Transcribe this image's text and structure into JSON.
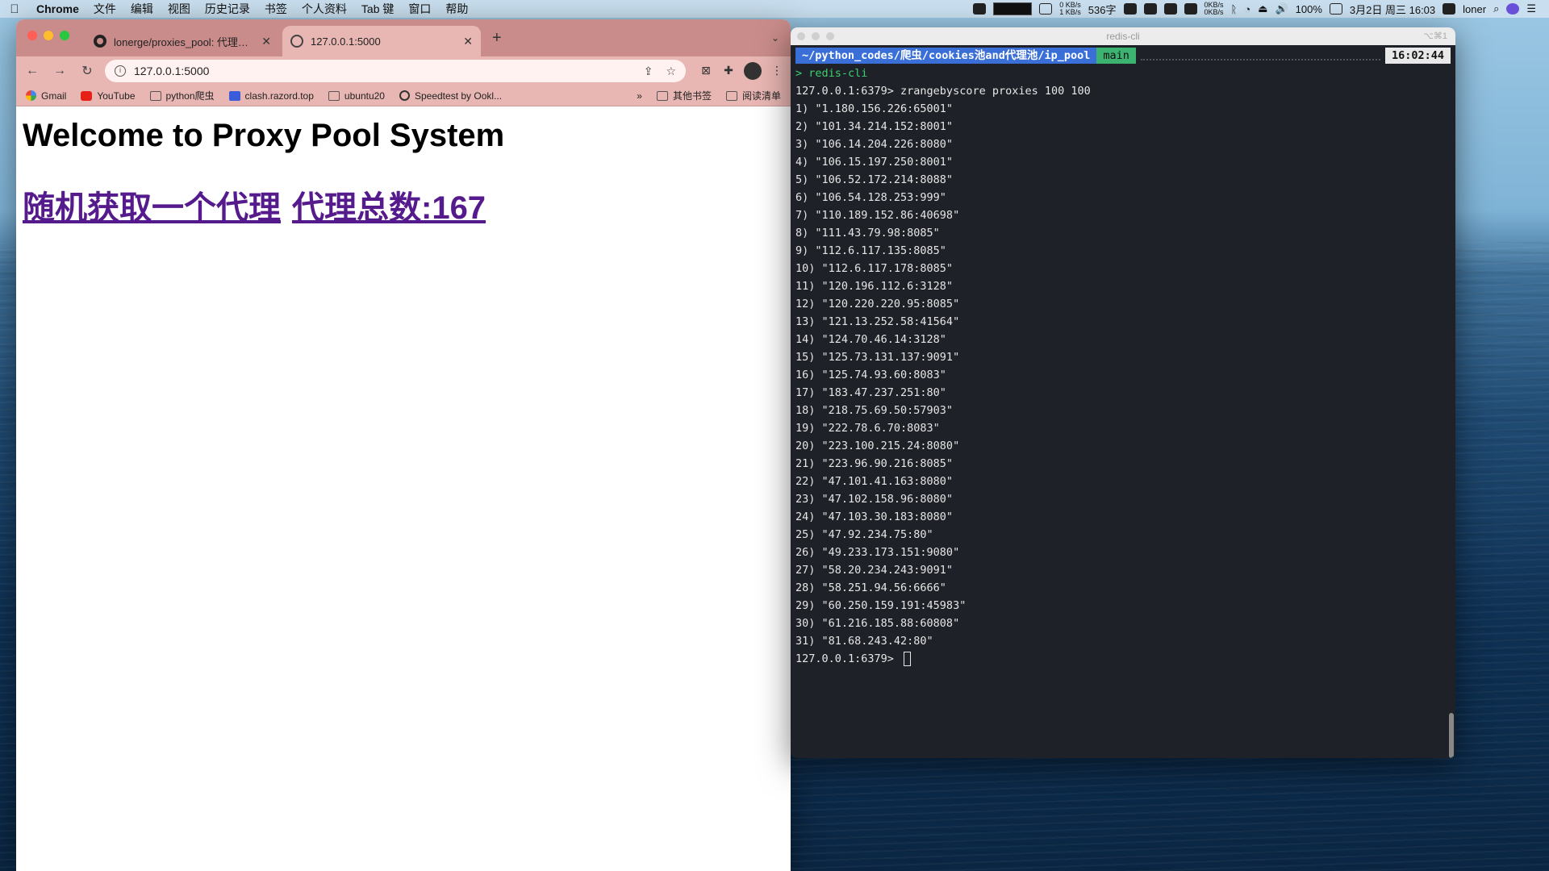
{
  "menubar": {
    "app": "Chrome",
    "items": [
      "文件",
      "编辑",
      "视图",
      "历史记录",
      "书签",
      "个人资料",
      "Tab 键",
      "窗口",
      "帮助"
    ],
    "status": {
      "net_up": "0 KB/s",
      "net_down": "1 KB/s",
      "mem": "536字",
      "net2_up": "0KB/s",
      "net2_down": "0KB/s",
      "battery": "100%",
      "datetime": "3月2日 周三 16:03",
      "user": "loner"
    }
  },
  "chrome": {
    "tabs": [
      {
        "title": "lonerge/proxies_pool: 代理池维",
        "active": false
      },
      {
        "title": "127.0.0.1:5000",
        "active": true
      }
    ],
    "url": "127.0.0.1:5000",
    "bookmarks": [
      {
        "label": "Gmail",
        "icon": "google-icon"
      },
      {
        "label": "YouTube",
        "icon": "youtube-icon"
      },
      {
        "label": "python爬虫",
        "icon": "folder-icon"
      },
      {
        "label": "clash.razord.top",
        "icon": "clash-icon"
      },
      {
        "label": "ubuntu20",
        "icon": "folder-icon"
      },
      {
        "label": "Speedtest by Ookl...",
        "icon": "speedtest-icon"
      }
    ],
    "bookmarks_overflow": "»",
    "other_bookmarks": "其他书签",
    "reading_list": "阅读清单",
    "page": {
      "heading": "Welcome to Proxy Pool System",
      "link_random": "随机获取一个代理",
      "link_count": "代理总数:167"
    }
  },
  "terminal": {
    "window_title": "redis-cli",
    "shortcut": "⌥⌘1",
    "path": "~/python_codes/爬虫/cookies池and代理池/ip_pool",
    "branch": "main",
    "clock": "16:02:44",
    "command_line": "> redis-cli",
    "query": "127.0.0.1:6379> zrangebyscore proxies 100 100",
    "results": [
      " 1) \"1.180.156.226:65001\"",
      " 2) \"101.34.214.152:8001\"",
      " 3) \"106.14.204.226:8080\"",
      " 4) \"106.15.197.250:8001\"",
      " 5) \"106.52.172.214:8088\"",
      " 6) \"106.54.128.253:999\"",
      " 7) \"110.189.152.86:40698\"",
      " 8) \"111.43.79.98:8085\"",
      " 9) \"112.6.117.135:8085\"",
      "10) \"112.6.117.178:8085\"",
      "11) \"120.196.112.6:3128\"",
      "12) \"120.220.220.95:8085\"",
      "13) \"121.13.252.58:41564\"",
      "14) \"124.70.46.14:3128\"",
      "15) \"125.73.131.137:9091\"",
      "16) \"125.74.93.60:8083\"",
      "17) \"183.47.237.251:80\"",
      "18) \"218.75.69.50:57903\"",
      "19) \"222.78.6.70:8083\"",
      "20) \"223.100.215.24:8080\"",
      "21) \"223.96.90.216:8085\"",
      "22) \"47.101.41.163:8080\"",
      "23) \"47.102.158.96:8080\"",
      "24) \"47.103.30.183:8080\"",
      "25) \"47.92.234.75:80\"",
      "26) \"49.233.173.151:9080\"",
      "27) \"58.20.234.243:9091\"",
      "28) \"58.251.94.56:6666\"",
      "29) \"60.250.159.191:45983\"",
      "30) \"61.216.185.88:60808\"",
      "31) \"81.68.243.42:80\""
    ],
    "final_prompt": "127.0.0.1:6379> "
  }
}
